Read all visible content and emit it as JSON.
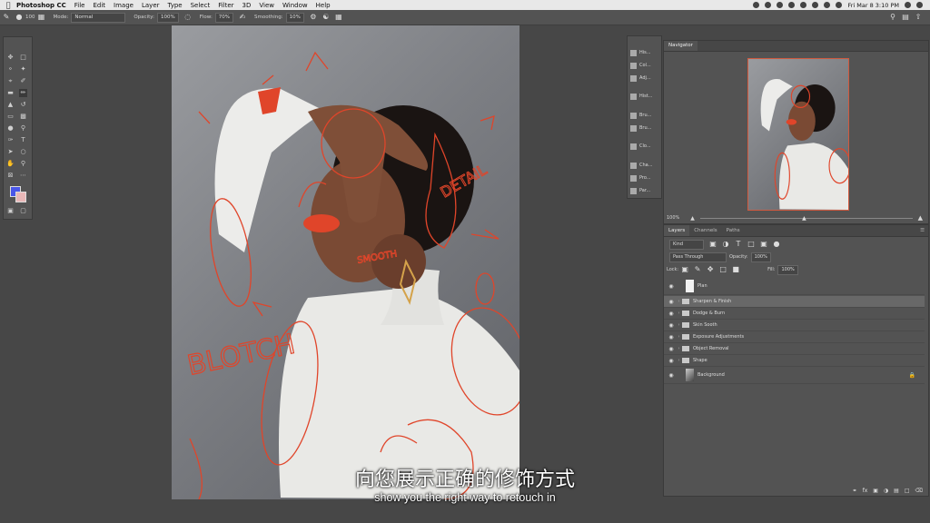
{
  "menubar": {
    "app_name": "Photoshop CC",
    "items": [
      "File",
      "Edit",
      "Image",
      "Layer",
      "Type",
      "Select",
      "Filter",
      "3D",
      "View",
      "Window",
      "Help"
    ],
    "clock": "Fri Mar 8  3:10 PM"
  },
  "options_bar": {
    "brush_size": "100",
    "mode_label": "Mode:",
    "mode_value": "Normal",
    "opacity_label": "Opacity:",
    "opacity_value": "100%",
    "flow_label": "Flow:",
    "flow_value": "70%",
    "smoothing_label": "Smoothing:",
    "smoothing_value": "10%"
  },
  "tools": [
    "move-tool",
    "marquee-tool",
    "lasso-tool",
    "magic-wand-tool",
    "crop-tool",
    "eyedropper-tool",
    "healing-brush-tool",
    "brush-tool",
    "clone-stamp-tool",
    "history-brush-tool",
    "eraser-tool",
    "gradient-tool",
    "blur-tool",
    "dodge-tool",
    "pen-tool",
    "type-tool",
    "path-select-tool",
    "shape-tool",
    "hand-tool",
    "zoom-tool",
    "frame-tool",
    "more-tools"
  ],
  "colors": {
    "foreground": "#4a56e8",
    "background": "#e8b7b7",
    "annotation": "#e0452a",
    "panel": "#535353"
  },
  "side_icons": [
    "His...",
    "Col...",
    "Adj...",
    "Hist...",
    "Bru...",
    "Bru...",
    "Clo...",
    "Cha...",
    "Pro...",
    "Par..."
  ],
  "navigator": {
    "title": "Navigator",
    "zoom": "100%"
  },
  "layers_panel": {
    "tabs": [
      "Layers",
      "Channels",
      "Paths"
    ],
    "kind": "Kind",
    "blend_mode": "Pass Through",
    "opacity_label": "Opacity:",
    "opacity_value": "100%",
    "lock_label": "Lock:",
    "fill_label": "Fill:",
    "fill_value": "100%",
    "layers": [
      {
        "name": "Plan",
        "type": "layer"
      },
      {
        "name": "Sharpen & Finish",
        "type": "group",
        "selected": true
      },
      {
        "name": "Dodge & Burn",
        "type": "group"
      },
      {
        "name": "Skin Sooth",
        "type": "group"
      },
      {
        "name": "Exposure Adjustments",
        "type": "group"
      },
      {
        "name": "Object Removal",
        "type": "group"
      },
      {
        "name": "Shape",
        "type": "group"
      },
      {
        "name": "Background",
        "type": "background"
      }
    ]
  },
  "canvas_annotations": [
    "DETAIL",
    "BLOTCH",
    "SMOOTH"
  ],
  "subtitles": {
    "chinese": "向您展示正确的修饰方式",
    "english": "show you the right way to retouch in"
  }
}
